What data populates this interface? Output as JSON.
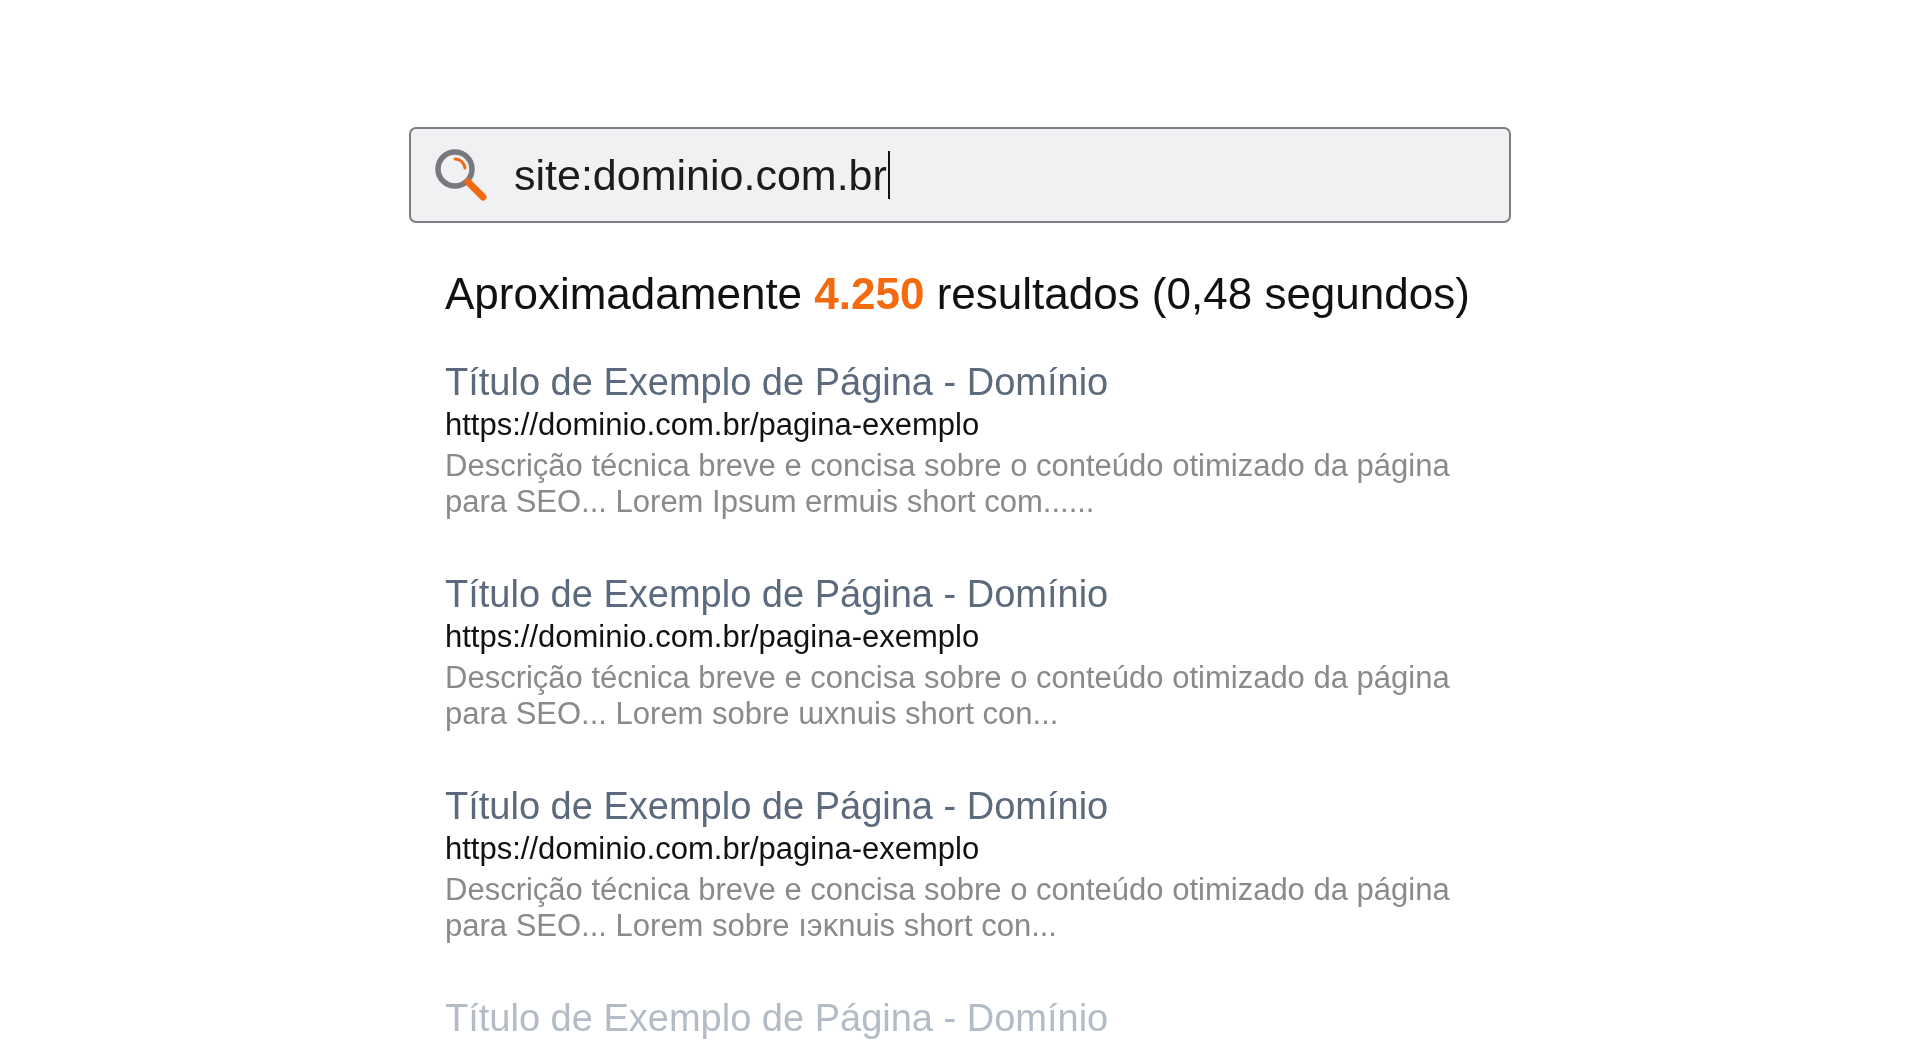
{
  "search": {
    "query": "site:dominio.com.br",
    "focused": true
  },
  "summary": "Aproximadamente **4.250** resultados (0,48 segundos)",
  "results": [
    {
      "title": "Título de Exemplo de Página - Domínio",
      "url": "https://dominio.com.br/pagina-exemplo",
      "description": "Descrição técnica breve e concisa sobre o conteúdo otimizado da página para SEO... Lorem Ipsum ermuis short com......",
      "dimmed": false
    },
    {
      "title": "Título de Exemplo de Página - Domínio",
      "url": "https://dominio.com.br/pagina-exemplo",
      "description": "Descrição técnica breve e concisa sobre o conteúdo otimizado da página para SEO... Lorem sobre ɯxnuis short con...",
      "dimmed": false
    },
    {
      "title": "Título de Exemplo de Página - Domínio",
      "url": "https://dominio.com.br/pagina-exemplo",
      "description": "Descrição técnica breve e concisa sobre o conteúdo otimizado da página para SEO... Lorem sobre ıэĸnuis short con...",
      "dimmed": false
    },
    {
      "title": "Título de Exemplo de Página - Domínio",
      "dimmed": true
    }
  ]
}
